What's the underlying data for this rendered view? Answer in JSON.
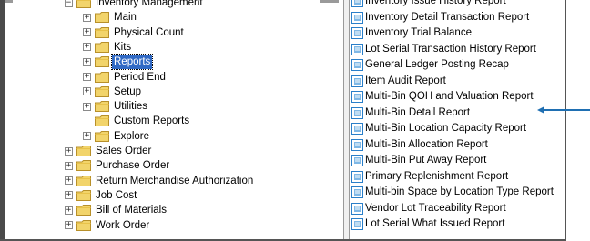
{
  "tree": {
    "items": [
      {
        "label": "Inventory Management",
        "expander": "−",
        "selected": false
      },
      {
        "label": "Main",
        "expander": "+",
        "selected": false
      },
      {
        "label": "Physical Count",
        "expander": "+",
        "selected": false
      },
      {
        "label": "Kits",
        "expander": "+",
        "selected": false
      },
      {
        "label": "Reports",
        "expander": "+",
        "selected": true
      },
      {
        "label": "Period End",
        "expander": "+",
        "selected": false
      },
      {
        "label": "Setup",
        "expander": "+",
        "selected": false
      },
      {
        "label": "Utilities",
        "expander": "+",
        "selected": false
      },
      {
        "label": "Custom Reports",
        "expander": "",
        "selected": false
      },
      {
        "label": "Explore",
        "expander": "+",
        "selected": false
      },
      {
        "label": "Sales Order",
        "expander": "+",
        "selected": false
      },
      {
        "label": "Purchase Order",
        "expander": "+",
        "selected": false
      },
      {
        "label": "Return Merchandise Authorization",
        "expander": "+",
        "selected": false
      },
      {
        "label": "Job Cost",
        "expander": "+",
        "selected": false
      },
      {
        "label": "Bill of Materials",
        "expander": "+",
        "selected": false
      },
      {
        "label": "Work Order",
        "expander": "+",
        "selected": false
      }
    ]
  },
  "reports": {
    "items": [
      {
        "label": "Inventory Issue History Report"
      },
      {
        "label": "Inventory Detail Transaction Report"
      },
      {
        "label": "Inventory Trial Balance"
      },
      {
        "label": "Lot Serial Transaction History Report"
      },
      {
        "label": "General Ledger Posting Recap"
      },
      {
        "label": "Item Audit Report"
      },
      {
        "label": "Multi-Bin QOH and Valuation Report"
      },
      {
        "label": "Multi-Bin Detail Report"
      },
      {
        "label": "Multi-Bin Location Capacity Report"
      },
      {
        "label": "Multi-Bin Allocation Report"
      },
      {
        "label": "Multi-Bin Put Away Report"
      },
      {
        "label": "Primary Replenishment Report"
      },
      {
        "label": "Multi-bin Space by Location Type Report"
      },
      {
        "label": "Vendor Lot Traceability Report"
      },
      {
        "label": "Lot Serial What Issued Report"
      }
    ]
  },
  "icons": {
    "folder": "folder-icon",
    "report": "report-icon",
    "expander": "expand-collapse-icon",
    "arrow": "callout-arrow-icon"
  },
  "colors": {
    "folder": "#f2d46b",
    "selection": "#316ac5",
    "report_icon": "#2a7fc9",
    "arrow": "#1f6fb2"
  }
}
